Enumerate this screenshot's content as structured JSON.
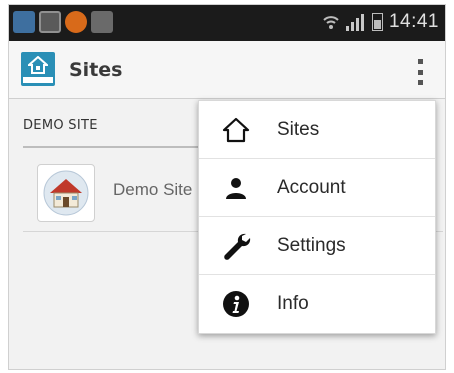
{
  "status_bar": {
    "time": "14:41",
    "icons": [
      "notification-icon",
      "sdcard-icon",
      "app-icon",
      "camera-icon",
      "wifi-icon",
      "signal-icon",
      "battery-icon"
    ]
  },
  "action_bar": {
    "title": "Sites",
    "logo_icon": "siemens-home-logo",
    "overflow_icon": "overflow-menu-icon"
  },
  "content": {
    "section_header": "DEMO SITE",
    "sites": [
      {
        "name": "Demo Site",
        "icon": "house-thumbnail"
      }
    ]
  },
  "menu": {
    "items": [
      {
        "label": "Sites",
        "icon": "home-icon"
      },
      {
        "label": "Account",
        "icon": "person-icon"
      },
      {
        "label": "Settings",
        "icon": "wrench-icon"
      },
      {
        "label": "Info",
        "icon": "info-icon"
      }
    ]
  },
  "colors": {
    "status_bar_bg": "#1b1b1b",
    "action_bar_bg": "#f6f6f6",
    "logo_blue": "#2a8fb6",
    "menu_bg": "#ffffff"
  }
}
